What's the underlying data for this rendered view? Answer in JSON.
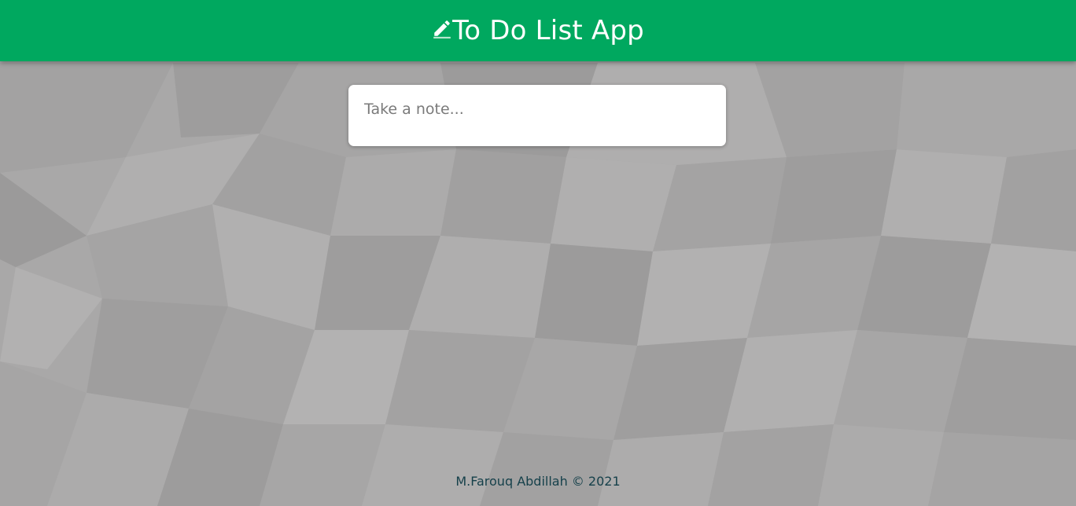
{
  "header": {
    "title": "To Do List App",
    "icon": "pencil-icon",
    "background_color": "#00a85f"
  },
  "note_input": {
    "placeholder": "Take a note...",
    "value": ""
  },
  "footer": {
    "text": "M.Farouq Abdillah © 2021",
    "color": "#16414b"
  },
  "page": {
    "background_color": "#a9a8a8"
  }
}
